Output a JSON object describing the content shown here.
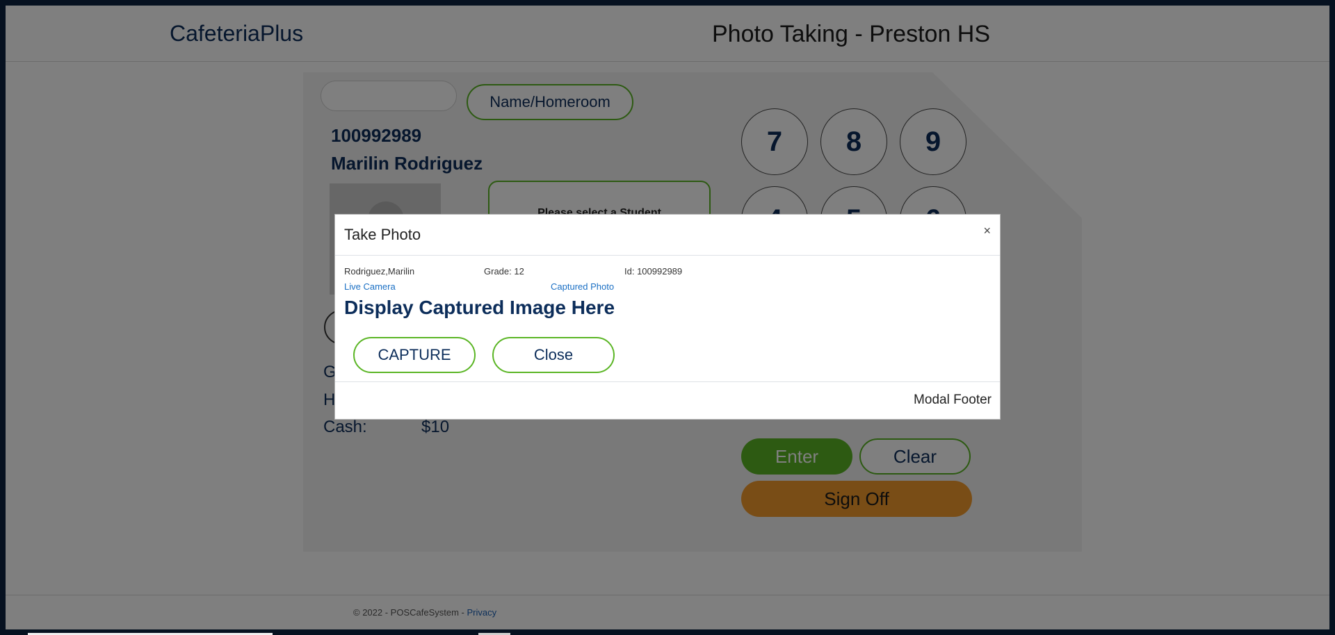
{
  "header": {
    "brand": "CafeteriaPlus",
    "title": "Photo Taking - Preston HS"
  },
  "lookup": {
    "search_value": "",
    "mode_button": "Name/Homeroom"
  },
  "student": {
    "id": "100992989",
    "name": "Marilin Rodriguez",
    "select_prompt": "Please select a Student",
    "info": [
      {
        "label": "G",
        "value": ""
      },
      {
        "label": "H",
        "value": ""
      },
      {
        "label": "Cash:",
        "value": "$10"
      }
    ]
  },
  "keypad": {
    "keys": [
      "7",
      "8",
      "9",
      "4",
      "5",
      "6"
    ]
  },
  "actions": {
    "enter": "Enter",
    "clear": "Clear",
    "sign_off": "Sign Off"
  },
  "footer": {
    "copyright": "© 2022 - POSCafeSystem - ",
    "privacy": "Privacy"
  },
  "modal": {
    "title": "Take Photo",
    "close_symbol": "×",
    "student_name": "Rodriguez,Marilin",
    "grade": "Grade: 12",
    "id": "Id: 100992989",
    "live_camera": "Live Camera",
    "captured_photo": "Captured Photo",
    "display_caption": "Display Captured Image Here",
    "capture_button": "CAPTURE",
    "close_button": "Close",
    "footer": "Modal Footer"
  },
  "colors": {
    "brand_navy": "#0c2d5a",
    "accent_green": "#5ab524",
    "sign_off_orange": "#f39a2c",
    "frame": "#0c2340"
  }
}
